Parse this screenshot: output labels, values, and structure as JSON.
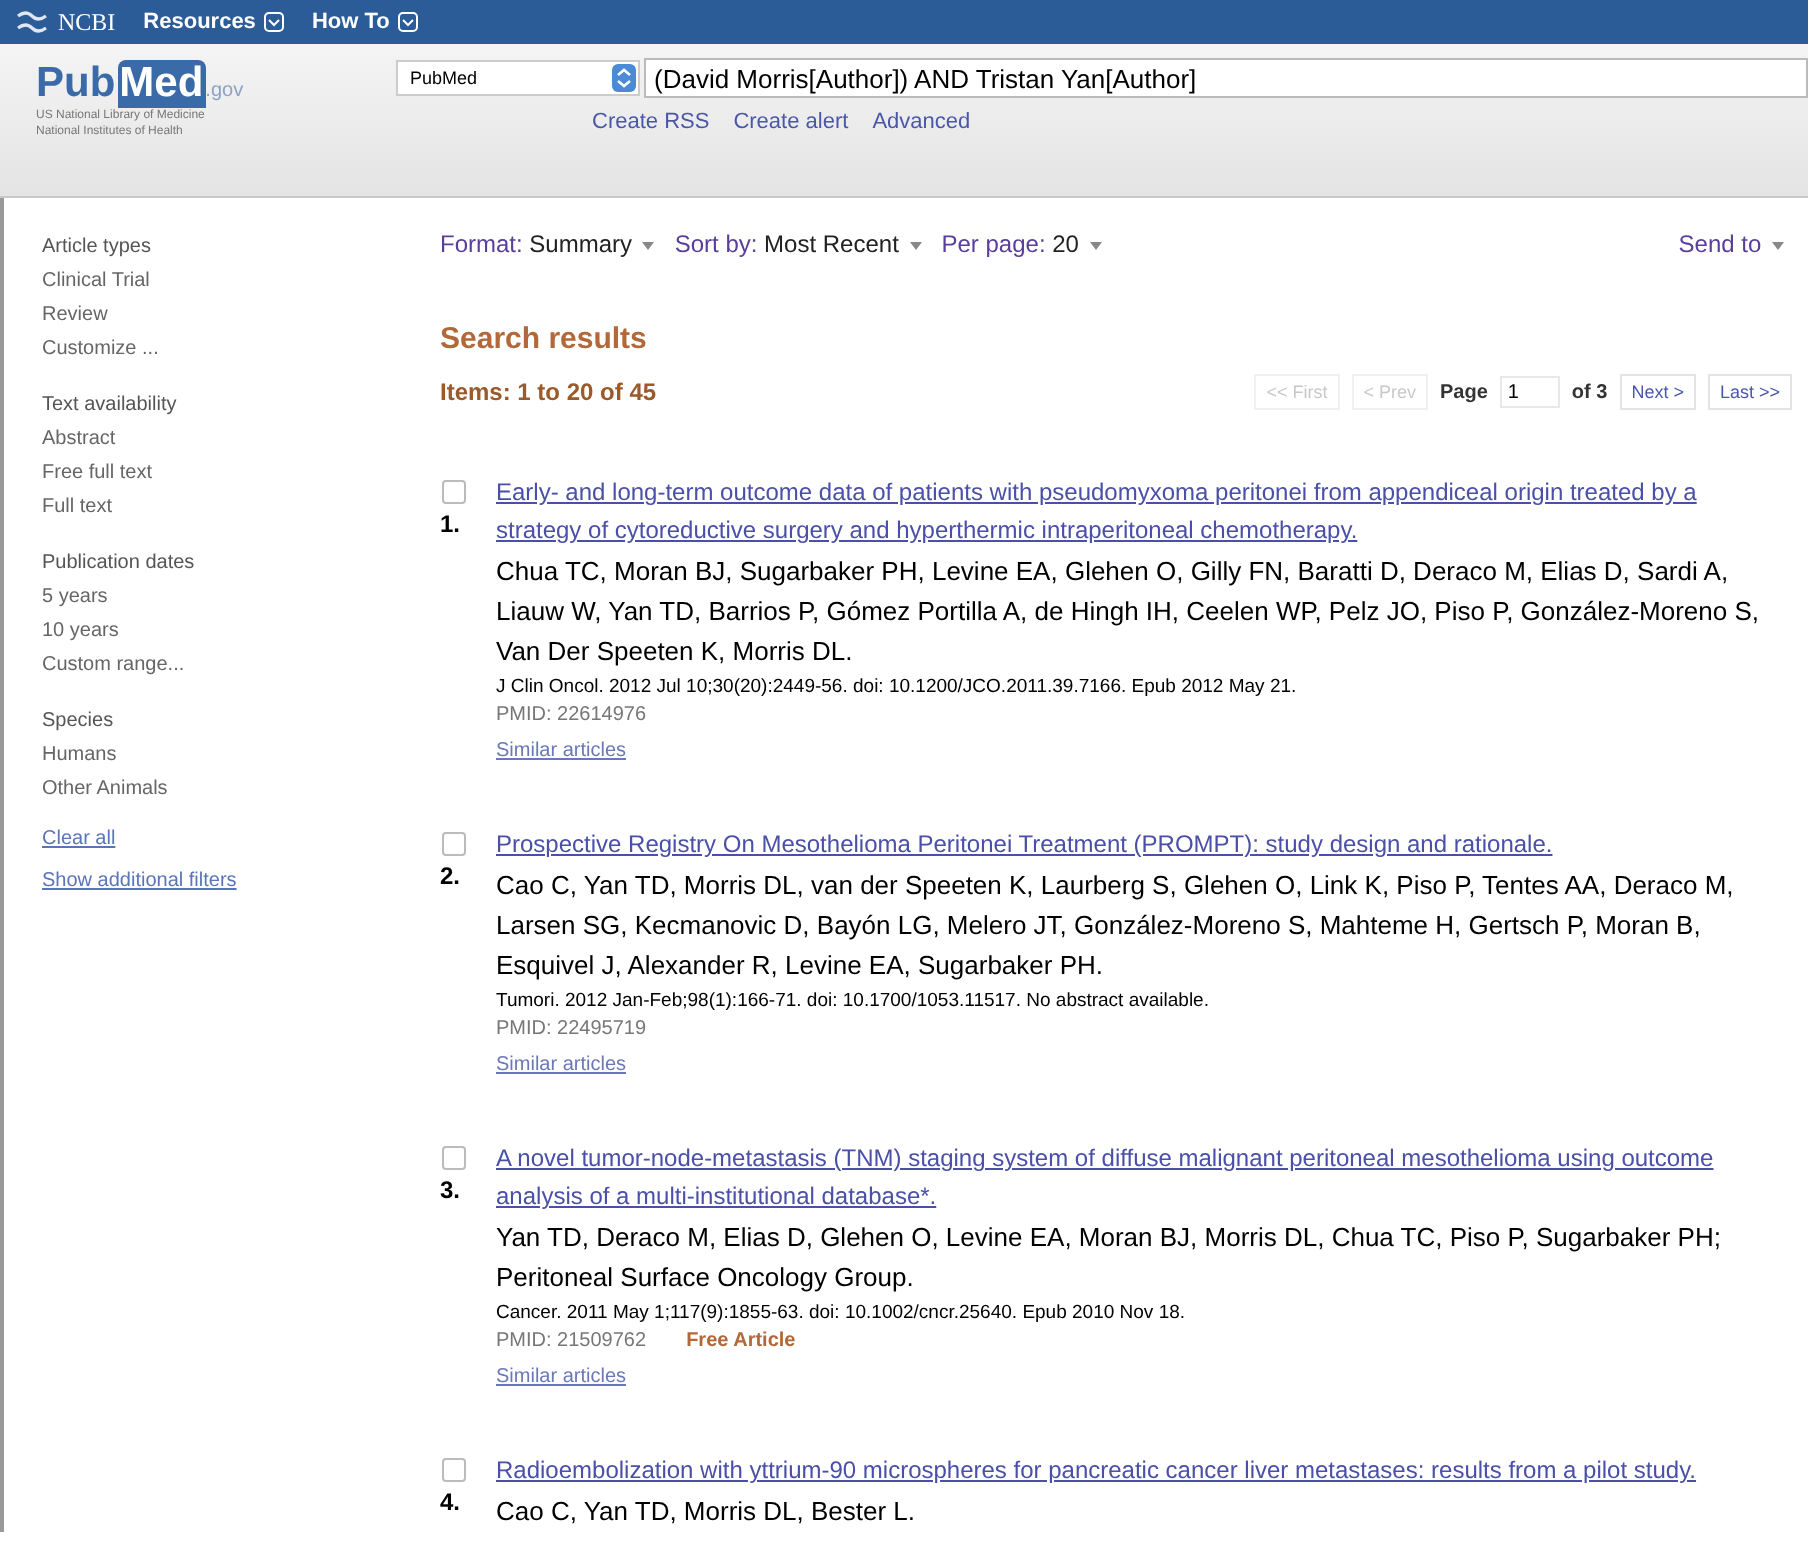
{
  "topbar": {
    "brand": "NCBI",
    "menus": [
      {
        "label": "Resources"
      },
      {
        "label": "How To"
      }
    ]
  },
  "header": {
    "logo": {
      "part_1": "Pub",
      "part_2": "Med",
      "part_3": ".gov"
    },
    "logo_caption": [
      "US National Library of Medicine",
      "National Institutes of Health"
    ],
    "database": "PubMed",
    "query": "(David Morris[Author]) AND Tristan Yan[Author]",
    "links": [
      "Create RSS",
      "Create alert",
      "Advanced"
    ]
  },
  "sidebar": {
    "groups": [
      {
        "title": "Article types",
        "items": [
          "Clinical Trial",
          "Review",
          "Customize ..."
        ]
      },
      {
        "title": "Text availability",
        "items": [
          "Abstract",
          "Free full text",
          "Full text"
        ]
      },
      {
        "title": "Publication dates",
        "items": [
          "5 years",
          "10 years",
          "Custom range..."
        ]
      },
      {
        "title": "Species",
        "items": [
          "Humans",
          "Other Animals"
        ]
      }
    ],
    "links": [
      "Clear all",
      "Show additional filters"
    ]
  },
  "display_bar": {
    "settings": [
      {
        "label": "Format:",
        "value": "Summary"
      },
      {
        "label": "Sort by:",
        "value": "Most Recent"
      },
      {
        "label": "Per page:",
        "value": "20"
      }
    ],
    "send_to": "Send to"
  },
  "results_heading": "Search results",
  "items_count": "Items: 1 to 20 of 45",
  "pager": {
    "buttons_before": [
      {
        "label": "<< First",
        "disabled": true
      },
      {
        "label": "< Prev",
        "disabled": true
      }
    ],
    "page_label": "Page",
    "page": "1",
    "of": "of 3",
    "buttons_after": [
      {
        "label": "Next >",
        "disabled": false
      },
      {
        "label": "Last >>",
        "disabled": false
      }
    ]
  },
  "results": [
    {
      "number": "1.",
      "checked": false,
      "title": "Early- and long-term outcome data of patients with pseudomyxoma peritonei from appendiceal origin treated by a strategy of cytoreductive surgery and hyperthermic intraperitoneal chemotherapy.",
      "authors": "Chua TC, Moran BJ, Sugarbaker PH, Levine EA, Glehen O, Gilly FN, Baratti D, Deraco M, Elias D, Sardi A, Liauw W, Yan TD, Barrios P, Gómez Portilla A, de Hingh IH, Ceelen WP, Pelz JO, Piso P, González-Moreno S, Van Der Speeten K, Morris DL.",
      "citation": "J Clin Oncol. 2012 Jul 10;30(20):2449-56. doi: 10.1200/JCO.2011.39.7166. Epub 2012 May 21.",
      "pmid": "PMID: 22614976",
      "similar": "Similar articles"
    },
    {
      "number": "2.",
      "checked": false,
      "title": "Prospective Registry On Mesothelioma Peritonei Treatment (PROMPT): study design and rationale.",
      "authors": "Cao C, Yan TD, Morris DL, van der Speeten K, Laurberg S, Glehen O, Link K, Piso P, Tentes AA, Deraco M, Larsen SG, Kecmanovic D, Bayón LG, Melero JT, González-Moreno S, Mahteme H, Gertsch P, Moran B, Esquivel J, Alexander R, Levine EA, Sugarbaker PH.",
      "citation": "Tumori. 2012 Jan-Feb;98(1):166-71. doi: 10.1700/1053.11517. No abstract available.",
      "pmid": "PMID: 22495719",
      "similar": "Similar articles"
    },
    {
      "number": "3.",
      "checked": false,
      "title": "A novel tumor-node-metastasis (TNM) staging system of diffuse malignant peritoneal mesothelioma using outcome analysis of a multi-institutional database*.",
      "authors": "Yan TD, Deraco M, Elias D, Glehen O, Levine EA, Moran BJ, Morris DL, Chua TC, Piso P, Sugarbaker PH; Peritoneal Surface Oncology Group.",
      "citation": "Cancer. 2011 May 1;117(9):1855-63. doi: 10.1002/cncr.25640. Epub 2010 Nov 18.",
      "pmid": "PMID: 21509762",
      "badge": "Free Article",
      "similar": "Similar articles"
    },
    {
      "number": "4.",
      "checked": false,
      "title": "Radioembolization with yttrium-90 microspheres for pancreatic cancer liver metastases: results from a pilot study.",
      "authors": "Cao C, Yan TD, Morris DL, Bester L."
    }
  ]
}
